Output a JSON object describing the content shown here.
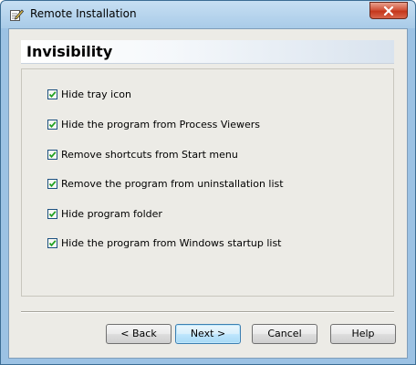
{
  "window": {
    "title": "Remote Installation",
    "title_icon": "pencil-notepad-icon",
    "close_icon": "close-icon"
  },
  "page": {
    "heading": "Invisibility"
  },
  "options": [
    {
      "label": "Hide tray icon",
      "checked": true
    },
    {
      "label": "Hide the program from Process Viewers",
      "checked": true
    },
    {
      "label": "Remove shortcuts from Start menu",
      "checked": true
    },
    {
      "label": "Remove the program from uninstallation list",
      "checked": true
    },
    {
      "label": "Hide program folder",
      "checked": true
    },
    {
      "label": "Hide the program from Windows startup list",
      "checked": true
    }
  ],
  "buttons": {
    "back": "< Back",
    "next": "Next >",
    "cancel": "Cancel",
    "help": "Help"
  },
  "colors": {
    "accent": "#3c7fb1",
    "close": "#c5371c",
    "frame": "#9cc2e4"
  }
}
